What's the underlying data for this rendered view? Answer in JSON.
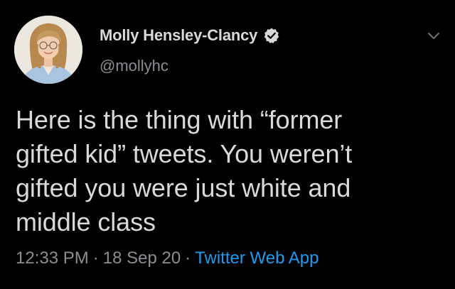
{
  "author": {
    "display_name": "Molly Hensley-Clancy",
    "handle": "@mollyhc",
    "verified": true
  },
  "tweet": {
    "text_lines": [
      "Here is the thing with “former",
      "gifted kid” tweets. You weren’t",
      "gifted you were just white and",
      "middle class"
    ],
    "time": "12:33 PM",
    "date": "18 Sep 20",
    "source": "Twitter Web App",
    "separator": "·"
  },
  "icons": {
    "verified": "verified-badge-icon",
    "menu": "chevron-down-icon"
  },
  "colors": {
    "background": "#000000",
    "primary_text": "#d9d9d9",
    "secondary_text": "#8a8d91",
    "link": "#1d9bf0"
  }
}
